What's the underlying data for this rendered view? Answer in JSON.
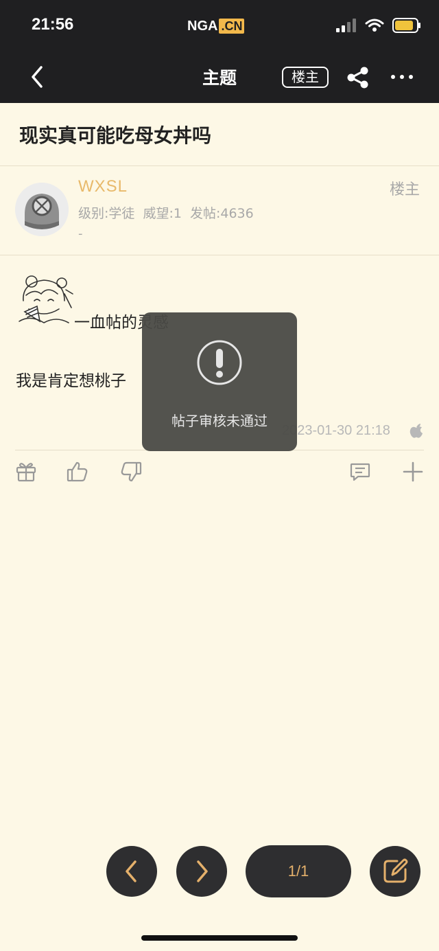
{
  "status_bar": {
    "time": "21:56",
    "logo_main": "NGA",
    "logo_suffix": ".CN",
    "icons": [
      "signal-icon",
      "wifi-icon",
      "battery-icon"
    ]
  },
  "header": {
    "title": "主题",
    "owner_filter_label": "楼主",
    "icons": [
      "back-icon",
      "share-icon",
      "more-icon"
    ]
  },
  "thread": {
    "title": "现实真可能吃母女丼吗"
  },
  "author": {
    "name": "WXSL",
    "meta": "级别:学徒 威望:1 发帖:4636",
    "signature": "-",
    "floor_label": "楼主"
  },
  "post": {
    "line1": "一血帖的灵感",
    "line2": "我是肯定想桃子",
    "timestamp": "2023-01-30 21:18",
    "device_icon": "apple-icon"
  },
  "actions": [
    "gift-icon",
    "thumbs-up-icon",
    "thumbs-down-icon",
    "comment-icon",
    "plus-icon"
  ],
  "toast": {
    "message": "帖子审核未通过",
    "icon": "exclamation-circle-icon"
  },
  "bottom_bar": {
    "page_indicator": "1/1",
    "icons": [
      "prev-page-icon",
      "next-page-icon",
      "edit-icon"
    ]
  },
  "colors": {
    "header_bg": "#1f1f21",
    "page_bg": "#fdf8e6",
    "accent": "#e4b06b",
    "author_name": "#e8b96a"
  }
}
